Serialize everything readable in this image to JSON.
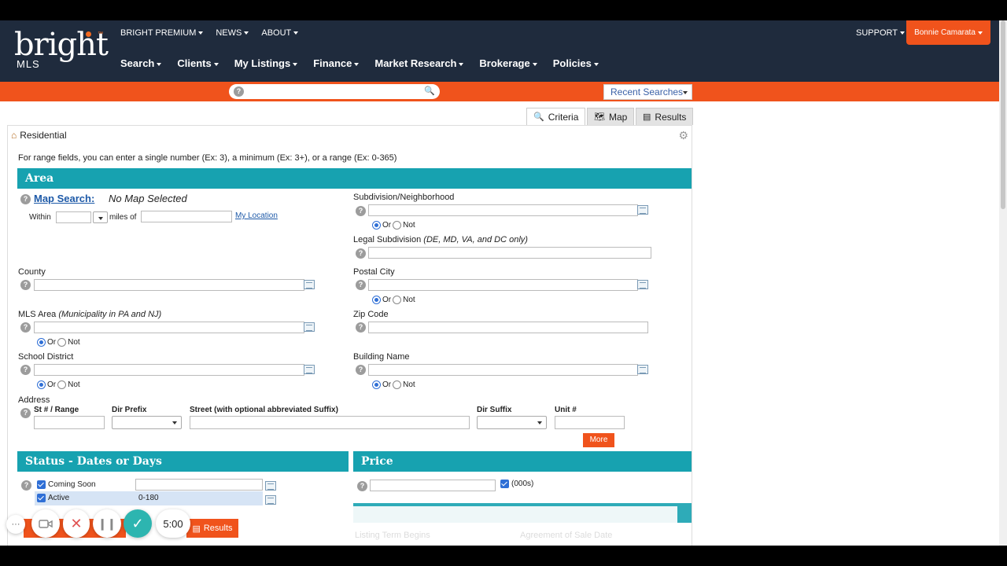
{
  "header": {
    "logo_word": "bright",
    "logo_sub": "MLS",
    "logo_tm": "™",
    "top_nav": [
      "BRIGHT PREMIUM",
      "NEWS",
      "ABOUT"
    ],
    "main_nav": [
      "Search",
      "Clients",
      "My Listings",
      "Finance",
      "Market Research",
      "Brokerage",
      "Policies"
    ],
    "support": "SUPPORT",
    "user": "Bonnie Camarata"
  },
  "search_bar": {
    "help": "?",
    "magnifier": "🔍",
    "recent_searches": "Recent Searches"
  },
  "tabs": [
    {
      "label": "Criteria",
      "icon": "🔍"
    },
    {
      "label": "Map",
      "icon": "🗺"
    },
    {
      "label": "Results",
      "icon": "▤"
    }
  ],
  "panel": {
    "title": "Residential",
    "hint": "For range fields, you can enter a single number (Ex: 3), a minimum (Ex: 3+), or a range (Ex: 0-365)"
  },
  "area": {
    "heading": "Area",
    "map_search_label": "Map Search:",
    "map_search_value": "No Map Selected",
    "within": "Within",
    "miles_of": "miles of",
    "my_location": "My Location",
    "county": "County",
    "mls_area": "MLS Area",
    "mls_area_note": "(Municipality in PA and NJ)",
    "school_district": "School District",
    "subdivision": "Subdivision/Neighborhood",
    "legal_subdivision": "Legal Subdivision",
    "legal_subdivision_note": "(DE, MD, VA, and DC only)",
    "postal_city": "Postal City",
    "zip_code": "Zip Code",
    "building_name": "Building Name",
    "or": "Or",
    "not": "Not",
    "address": "Address",
    "address_cols": [
      "St # / Range",
      "Dir Prefix",
      "Street (with optional abbreviated Suffix)",
      "Dir Suffix",
      "Unit #"
    ],
    "more": "More"
  },
  "status": {
    "heading": "Status - Dates or Days",
    "coming_soon": "Coming Soon",
    "active": "Active",
    "active_value": "0-180"
  },
  "price": {
    "heading": "Price",
    "unit": "(000s)"
  },
  "faded": {
    "listing_term": "Listing Term Begins",
    "agreement": "Agreement of Sale Date"
  },
  "results_button": "Results",
  "recorder": {
    "dots": "···",
    "time": "5:00"
  }
}
